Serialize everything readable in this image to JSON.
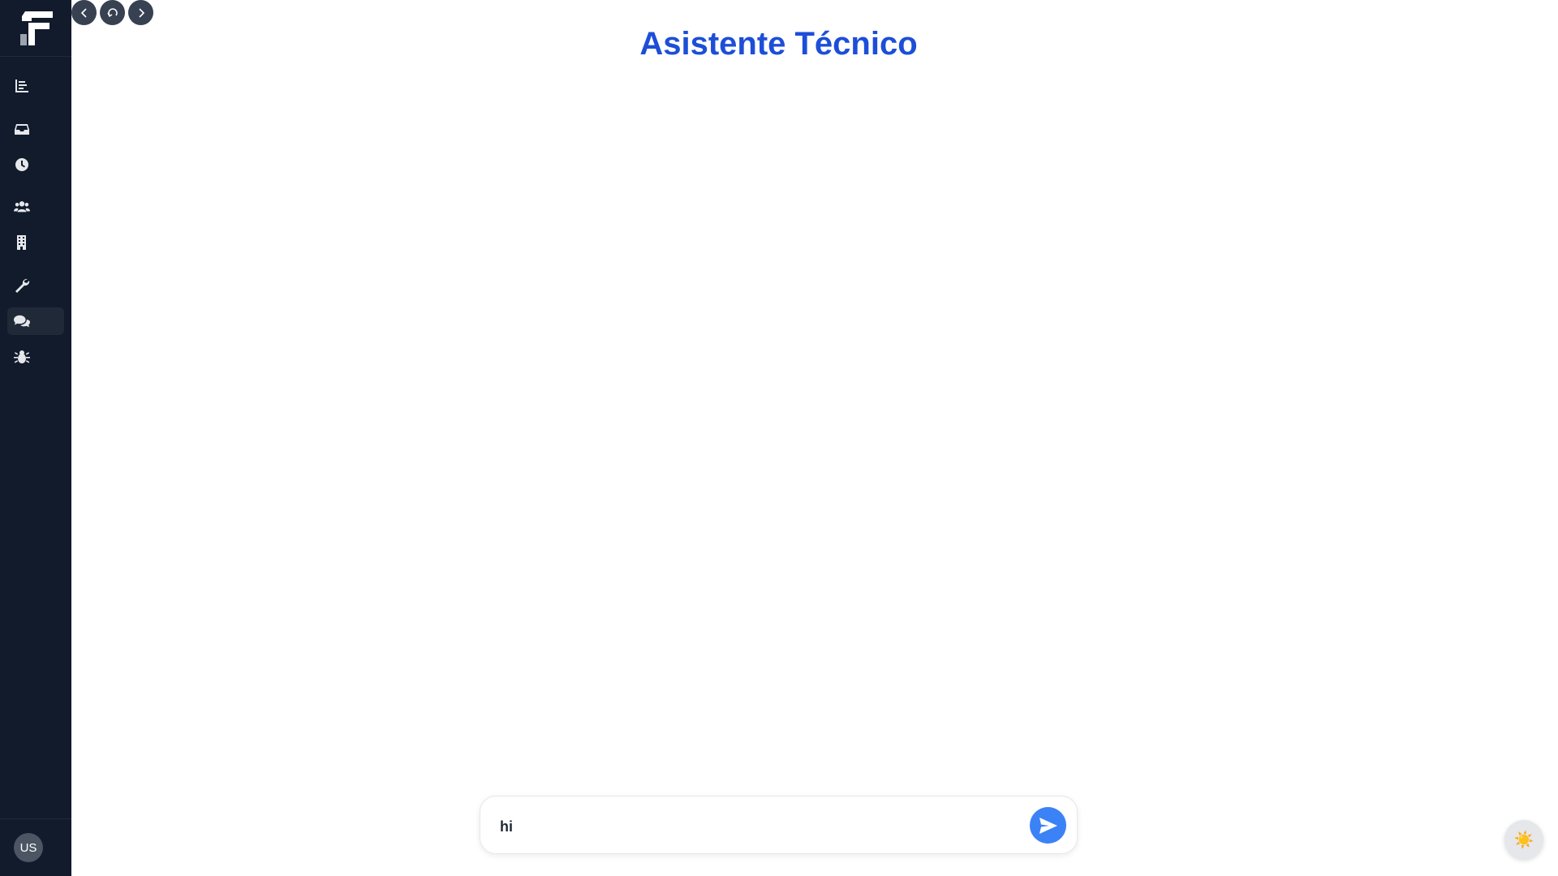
{
  "header": {
    "title": "Asistente Técnico"
  },
  "sidebar": {
    "items": [
      {
        "icon": "chart-bar-icon",
        "active": false
      },
      {
        "icon": "inbox-icon",
        "active": false
      },
      {
        "icon": "clock-icon",
        "active": false
      },
      {
        "icon": "users-icon",
        "active": false
      },
      {
        "icon": "building-icon",
        "active": false
      },
      {
        "icon": "wrench-icon",
        "active": false
      },
      {
        "icon": "comments-icon",
        "active": true
      },
      {
        "icon": "bug-icon",
        "active": false
      }
    ],
    "user_initials": "US"
  },
  "browser_controls": {
    "back_icon": "chevron-left-icon",
    "reload_icon": "reload-icon",
    "forward_icon": "chevron-right-icon"
  },
  "chat": {
    "input_value": "hi",
    "send_icon": "paper-plane-icon"
  },
  "theme_toggle": {
    "icon": "sun-icon",
    "glyph": "☀️"
  },
  "colors": {
    "sidebar_bg": "#111b2c",
    "title": "#1d4ed8",
    "send_button": "#3b82f6"
  }
}
